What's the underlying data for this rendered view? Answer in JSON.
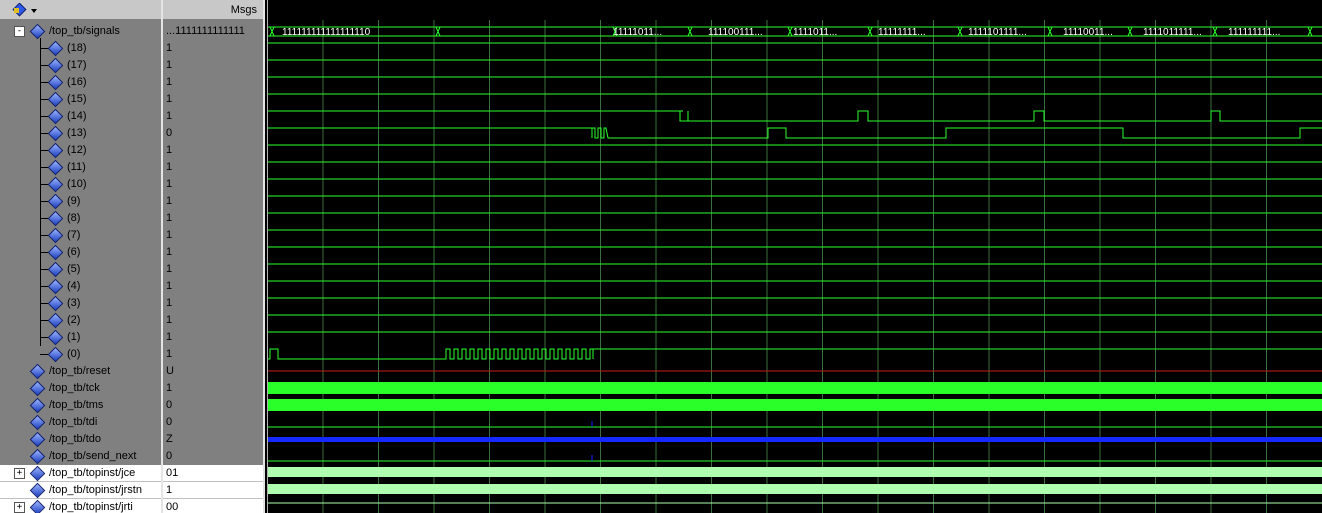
{
  "header": {
    "msgs_label": "Msgs"
  },
  "rows": [
    {
      "name": "/top_tb/signals",
      "value": "...1111111111111",
      "indent": 0,
      "expander": "-",
      "kind": "bus"
    },
    {
      "name": "(18)",
      "value": "1",
      "indent": 1,
      "kind": "bit"
    },
    {
      "name": "(17)",
      "value": "1",
      "indent": 1,
      "kind": "bit"
    },
    {
      "name": "(16)",
      "value": "1",
      "indent": 1,
      "kind": "bit"
    },
    {
      "name": "(15)",
      "value": "1",
      "indent": 1,
      "kind": "bit"
    },
    {
      "name": "(14)",
      "value": "1",
      "indent": 1,
      "kind": "bit"
    },
    {
      "name": "(13)",
      "value": "0",
      "indent": 1,
      "kind": "bit"
    },
    {
      "name": "(12)",
      "value": "1",
      "indent": 1,
      "kind": "bit"
    },
    {
      "name": "(11)",
      "value": "1",
      "indent": 1,
      "kind": "bit"
    },
    {
      "name": "(10)",
      "value": "1",
      "indent": 1,
      "kind": "bit"
    },
    {
      "name": "(9)",
      "value": "1",
      "indent": 1,
      "kind": "bit"
    },
    {
      "name": "(8)",
      "value": "1",
      "indent": 1,
      "kind": "bit"
    },
    {
      "name": "(7)",
      "value": "1",
      "indent": 1,
      "kind": "bit"
    },
    {
      "name": "(6)",
      "value": "1",
      "indent": 1,
      "kind": "bit"
    },
    {
      "name": "(5)",
      "value": "1",
      "indent": 1,
      "kind": "bit"
    },
    {
      "name": "(4)",
      "value": "1",
      "indent": 1,
      "kind": "bit"
    },
    {
      "name": "(3)",
      "value": "1",
      "indent": 1,
      "kind": "bit"
    },
    {
      "name": "(2)",
      "value": "1",
      "indent": 1,
      "kind": "bit"
    },
    {
      "name": "(1)",
      "value": "1",
      "indent": 1,
      "kind": "bit"
    },
    {
      "name": "(0)",
      "value": "1",
      "indent": 1,
      "kind": "bit"
    },
    {
      "name": "/top_tb/reset",
      "value": "U",
      "indent": 0,
      "kind": "reset"
    },
    {
      "name": "/top_tb/tck",
      "value": "1",
      "indent": 0,
      "kind": "clock"
    },
    {
      "name": "/top_tb/tms",
      "value": "0",
      "indent": 0,
      "kind": "clock"
    },
    {
      "name": "/top_tb/tdi",
      "value": "0",
      "indent": 0,
      "kind": "tdi"
    },
    {
      "name": "/top_tb/tdo",
      "value": "Z",
      "indent": 0,
      "kind": "z"
    },
    {
      "name": "/top_tb/send_next",
      "value": "0",
      "indent": 0,
      "kind": "tdi"
    },
    {
      "name": "/top_tb/topinst/jce",
      "value": "01",
      "indent": 0,
      "expander": "+",
      "kind": "pale",
      "light": true
    },
    {
      "name": "/top_tb/topinst/jrstn",
      "value": "1",
      "indent": 0,
      "kind": "pale",
      "light": true
    },
    {
      "name": "/top_tb/topinst/jrti",
      "value": "00",
      "indent": 0,
      "expander": "+",
      "kind": "pale2",
      "light": true
    }
  ],
  "bus_labels": [
    "111111111111111110",
    "11111011...",
    "111100111...",
    "1111011...",
    "11111111...",
    "1111101111...",
    "11110011...",
    "1111011111...",
    "111111111..."
  ],
  "jrti_label": "00",
  "colors": {
    "wave": "#2aff2a",
    "grid": "#3a6e3a",
    "reset": "#c81e1e",
    "z": "#1428ff",
    "pale": "#b0ffb0"
  }
}
